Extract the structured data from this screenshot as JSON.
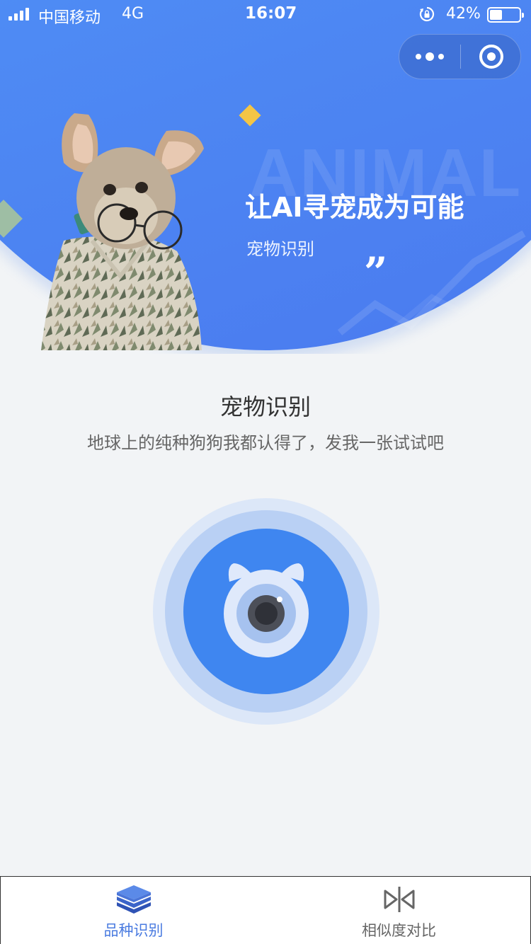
{
  "status_bar": {
    "carrier": "中国移动",
    "network": "4G",
    "time": "16:07",
    "battery_percent": "42%",
    "battery_level": 0.42
  },
  "hero": {
    "watermark": "ANIMAL",
    "title": "让AI寻宠成为可能",
    "subtitle": "宠物识别",
    "quote_mark": "”"
  },
  "main": {
    "title": "宠物识别",
    "description": "地球上的纯种狗狗我都认得了，发我一张试试吧"
  },
  "tabs": [
    {
      "label": "品种识别",
      "icon": "layers-icon",
      "active": true
    },
    {
      "label": "相似度对比",
      "icon": "compare-icon",
      "active": false
    }
  ],
  "colors": {
    "accent": "#3f86f0",
    "tab_active": "#4a7be0",
    "tab_inactive": "#666666",
    "background": "#f2f4f6"
  }
}
